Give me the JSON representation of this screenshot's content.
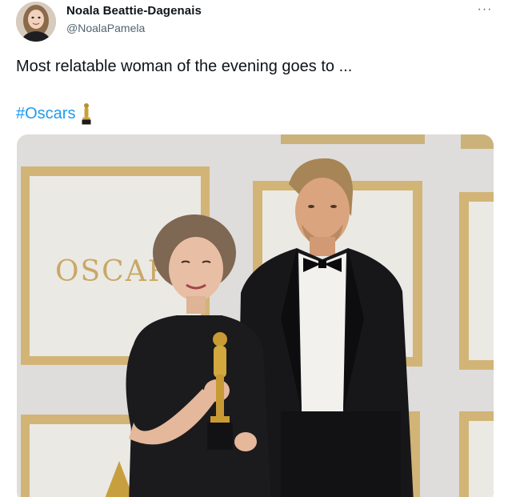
{
  "author": {
    "display_name": "Noala Beattie-Dagenais",
    "handle": "@NoalaPamela"
  },
  "tweet": {
    "text": "Most relatable woman of the evening goes to ...",
    "hashtag": "#Oscars",
    "emoji": "oscar-trophy"
  },
  "menu": {
    "more_label": "···"
  },
  "photo": {
    "backdrop_wordmark": "OSCAR",
    "subject_left": "woman holding oscar statuette",
    "subject_right": "man in tuxedo"
  },
  "colors": {
    "hashtag": "#1d9bf0",
    "name": "#0f1419",
    "handle": "#536471",
    "backdrop": "#dcdcdc",
    "gold_frame": "#cfb06a"
  }
}
